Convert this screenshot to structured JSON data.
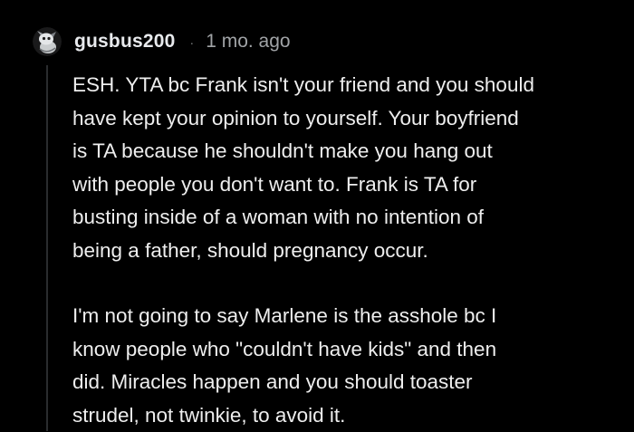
{
  "comment": {
    "author": {
      "username": "gusbus200",
      "avatar_icon": "snoo-avatar-icon"
    },
    "separator": "·",
    "timestamp": "1 mo. ago",
    "paragraphs": [
      {
        "lines": [
          "ESH. YTA bc Frank isn't your friend and you should",
          "have kept your opinion to yourself. Your boyfriend",
          "is TA because he shouldn't make you hang out",
          "with people you don't want to. Frank is TA for",
          "busting inside of a woman with no intention of",
          "being a father, should pregnancy occur."
        ]
      },
      {
        "lines": [
          "I'm not going to say Marlene is the asshole bc I",
          "know people who \"couldn't have kids\" and then",
          "did. Miracles happen and you should toaster",
          "strudel, not twinkie, to avoid it."
        ]
      }
    ]
  },
  "colors": {
    "background": "#000000",
    "text": "#eeeeee",
    "meta": "#a0a3a6",
    "thread_line": "#2a2c2e"
  }
}
